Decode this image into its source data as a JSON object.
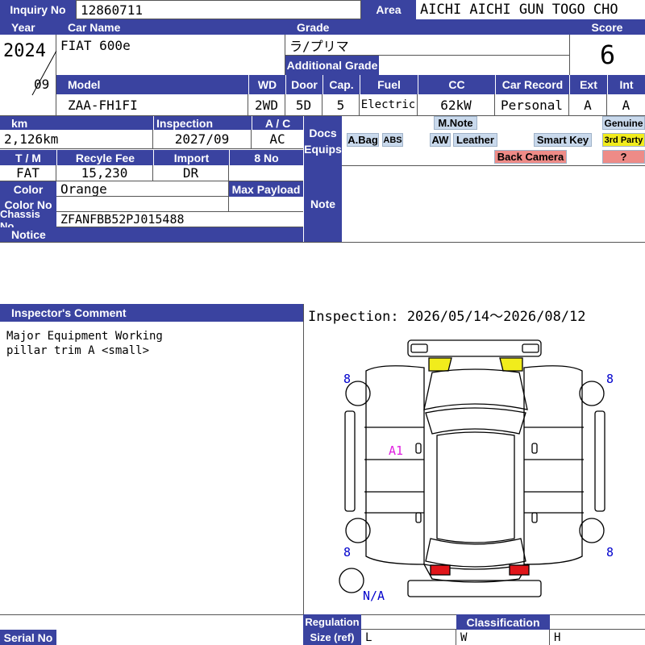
{
  "header": {
    "inquiry_label": "Inquiry No",
    "inquiry_no": "12860711",
    "area_label": "Area",
    "area": "AICHI AICHI GUN TOGO CHO"
  },
  "row1": {
    "year_label": "Year",
    "car_name_label": "Car Name",
    "grade_label": "Grade",
    "score_label": "Score",
    "year": "2024",
    "month": "09",
    "car_name": "FIAT 600e",
    "grade": "ラ/プリマ",
    "additional_grade_label": "Additional Grade",
    "score": "6"
  },
  "row2": {
    "model_label": "Model",
    "wd_label": "WD",
    "door_label": "Door",
    "cap_label": "Cap.",
    "fuel_label": "Fuel",
    "cc_label": "CC",
    "record_label": "Car Record",
    "ext_label": "Ext",
    "int_label": "Int",
    "model": "ZAA-FH1FI",
    "wd": "2WD",
    "door": "5D",
    "cap": "5",
    "fuel": "Electric",
    "cc": "62kW",
    "record": "Personal",
    "ext": "A",
    "int": "A"
  },
  "row3": {
    "km_label": "km",
    "inspection_label": "Inspection",
    "ac_label": "A / C",
    "km": "2,126km",
    "inspection": "2027/09",
    "ac": "AC",
    "tm_label": "T / M",
    "recycle_label": "Recyle Fee",
    "import_label": "Import",
    "eight_no_label": "8 No",
    "tm": "FAT",
    "recycle": "15,230",
    "import": "DR",
    "color_label": "Color",
    "color": "Orange",
    "max_payload_label": "Max Payload",
    "color_no_label": "Color No",
    "chassis_label": "Chassis No",
    "chassis": "ZFANFBB52PJ015488",
    "notice_label": "Notice"
  },
  "docs": {
    "label_docs": "Docs",
    "label_equips": "Equips",
    "mnote": "M.Note",
    "genuine": "Genuine",
    "abag": "A.Bag",
    "abs": "ABS",
    "aw": "AW",
    "leather": "Leather",
    "smart_key": "Smart Key",
    "third_party": "3rd Party",
    "back_camera": "Back Camera",
    "question": "?"
  },
  "note_label": "Note",
  "comment": {
    "label": "Inspector's Comment",
    "lines": [
      "Major Equipment Working",
      "pillar trim A <small>"
    ]
  },
  "inspection_period": "Inspection: 2026/05/14～2026/08/12",
  "diagram": {
    "marks": {
      "tl": "8",
      "tr": "8",
      "bl": "8",
      "br": "8",
      "a1": "A1",
      "na": "N/A"
    },
    "colors": {
      "highlight_yellow": "#f1ec1c",
      "highlight_red": "#e0151a",
      "mark_blue": "#0000cc",
      "mark_magenta": "#e01ee0"
    }
  },
  "footer": {
    "serial_label": "Serial No",
    "regulation_label": "Regulation",
    "classification_label": "Classification",
    "size_label": "Size (ref)",
    "l": "L",
    "w": "W",
    "h": "H"
  }
}
